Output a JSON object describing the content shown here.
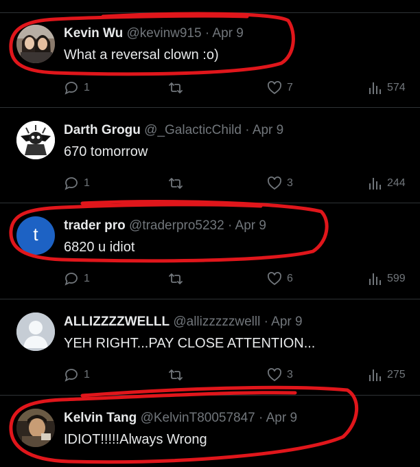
{
  "tweets": [
    {
      "name": "Kevin Wu",
      "handle": "@kevinw915",
      "date": "Apr 9",
      "text": "What a reversal clown :o)",
      "replies": "1",
      "likes": "7",
      "views": "574",
      "avatar": "photo-two-people"
    },
    {
      "name": "Darth Grogu",
      "handle": "@_GalacticChild",
      "date": "Apr 9",
      "text": "670 tomorrow",
      "replies": "1",
      "likes": "3",
      "views": "244",
      "avatar": "grogu-illustration"
    },
    {
      "name": "trader pro",
      "handle": "@traderpro5232",
      "date": "Apr 9",
      "text": "6820 u idiot",
      "replies": "1",
      "likes": "6",
      "views": "599",
      "avatar": "letter-t",
      "avatar_letter": "t"
    },
    {
      "name": "ALLIZZZZWELLL",
      "handle": "@allizzzzzwelll",
      "date": "Apr 9",
      "text": "YEH RIGHT...PAY CLOSE ATTENTION...",
      "replies": "1",
      "likes": "3",
      "views": "275",
      "avatar": "default-silhouette"
    },
    {
      "name": "Kelvin Tang",
      "handle": "@KelvinT80057847",
      "date": "Apr 9",
      "text": "IDIOT!!!!!Always Wrong",
      "avatar": "photo-person"
    }
  ],
  "colors": {
    "background": "#000000",
    "text": "#e7e9ea",
    "muted": "#71767b",
    "annotation": "#e0161b",
    "avatar_t": "#1d62c4"
  },
  "separator": "·"
}
